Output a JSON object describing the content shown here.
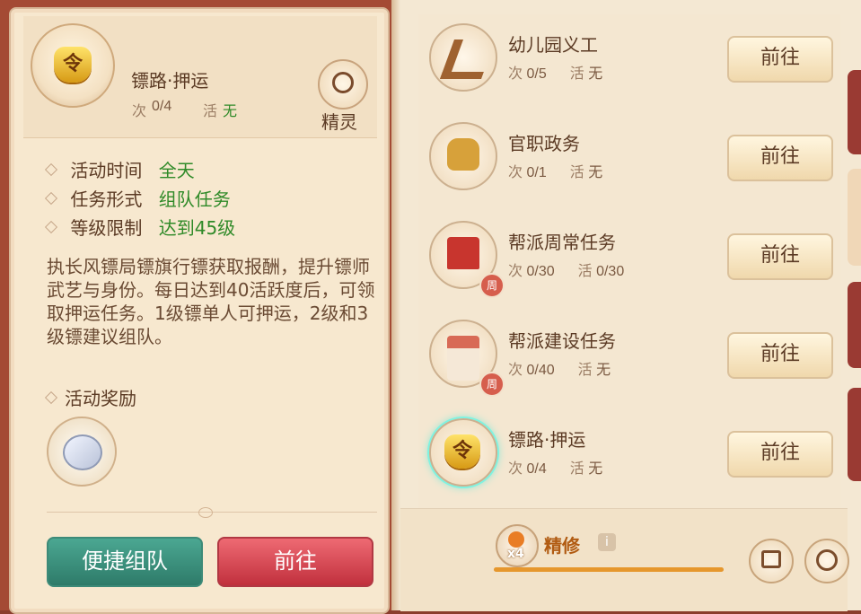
{
  "left_panel": {
    "title": "镖路·押运",
    "count_label": "次",
    "count_value": "0/4",
    "active_label": "活",
    "active_value": "无",
    "spirit_label": "精灵",
    "info_rows": [
      {
        "label": "活动时间",
        "value": "全天"
      },
      {
        "label": "任务形式",
        "value": "组队任务"
      },
      {
        "label": "等级限制",
        "value": "达到45级"
      }
    ],
    "description": "执长风镖局镖旗行镖获取报酬，提升镖师武艺与身份。每日达到40活跃度后，可领取押运任务。1级镖单人可押运，2级和3级镖建议组队。",
    "reward_title": "活动奖励",
    "quick_team_label": "便捷组队",
    "go_label": "前往"
  },
  "tasks": [
    {
      "title": "幼儿园义工",
      "count_label": "次",
      "count": "0/5",
      "active_label": "活",
      "active": "无",
      "button": "前往",
      "icon": "rocking-horse-icon",
      "badge": ""
    },
    {
      "title": "官职政务",
      "count_label": "次",
      "count": "0/1",
      "active_label": "活",
      "active": "无",
      "button": "前往",
      "icon": "golden-lion-icon",
      "badge": ""
    },
    {
      "title": "帮派周常任务",
      "count_label": "次",
      "count": "0/30",
      "active_label": "活",
      "active": "0/30",
      "button": "前往",
      "icon": "gang-banner-icon",
      "badge": "周"
    },
    {
      "title": "帮派建设任务",
      "count_label": "次",
      "count": "0/40",
      "active_label": "活",
      "active": "无",
      "button": "前往",
      "icon": "gang-building-icon",
      "badge": "周"
    },
    {
      "title": "镖路·押运",
      "count_label": "次",
      "count": "0/4",
      "active_label": "活",
      "active": "无",
      "button": "前往",
      "icon": "escort-token-icon",
      "badge": ""
    }
  ],
  "bottom": {
    "boost_multiplier": "x4",
    "boost_label": "精修",
    "info_glyph": "i",
    "progress_fraction": 1
  },
  "icons": {
    "left_activity_icon": "escort-token-icon",
    "spirit_icon": "spirit-face-icon",
    "reward_icon": "silver-coin-icon",
    "calendar_icon": "calendar-icon",
    "alarm_icon": "alarm-clock-icon"
  }
}
